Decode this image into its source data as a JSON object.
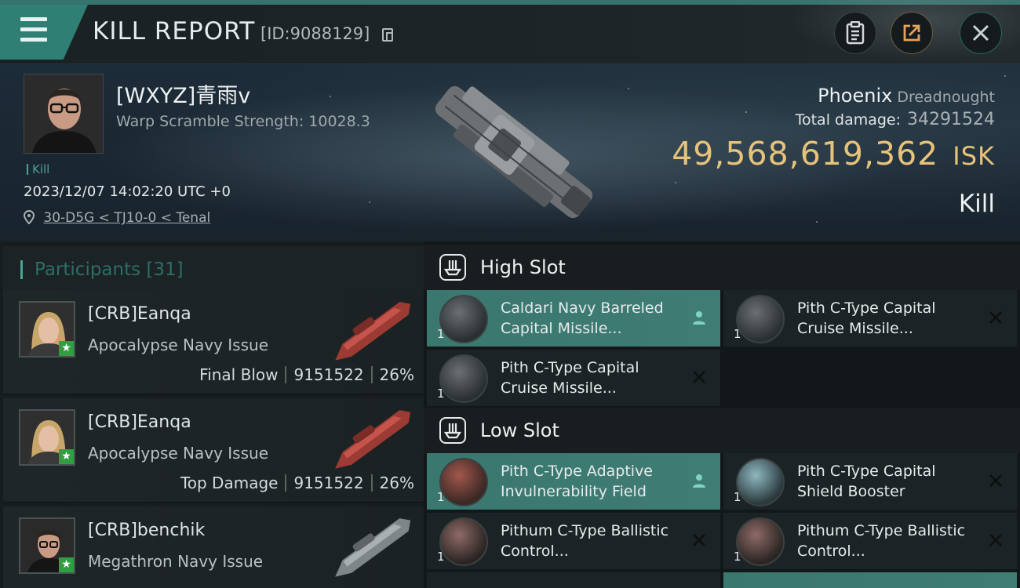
{
  "header": {
    "title": "KILL REPORT",
    "report_id": "[ID:9088129]"
  },
  "victim": {
    "name": "[WXYZ]青雨v",
    "warp_scramble": "Warp Scramble Strength: 10028.3",
    "kill_tag": "Kill",
    "time": "2023/12/07 14:02:20 UTC +0",
    "location": "30-D5G < TJ10-0 < Tenal",
    "ship_name": "Phoenix",
    "ship_class": "Dreadnought",
    "total_damage_label": "Total damage:",
    "total_damage_value": "34291524",
    "isk_value": "49,568,619,362",
    "isk_unit": "ISK",
    "result_label": "Kill"
  },
  "participants": {
    "label": "Participants",
    "count": "[31]",
    "rows": [
      {
        "name": "[CRB]Eanqa",
        "ship": "Apocalypse Navy Issue",
        "role": "Final Blow",
        "damage": "9151522",
        "percent": "26%"
      },
      {
        "name": "[CRB]Eanqa",
        "ship": "Apocalypse Navy Issue",
        "role": "Top Damage",
        "damage": "9151522",
        "percent": "26%"
      },
      {
        "name": "[CRB]benchik",
        "ship": "Megathron Navy Issue",
        "role": "",
        "damage": "",
        "percent": ""
      }
    ]
  },
  "fitting": {
    "high_slot_label": "High Slot",
    "low_slot_label": "Low Slot",
    "high": [
      {
        "name": "Caldari Navy Barreled Capital Missile...",
        "qty": "1",
        "status": "dropped"
      },
      {
        "name": "Pith C-Type Capital Cruise Missile...",
        "qty": "1",
        "status": "destroyed"
      },
      {
        "name": "Pith C-Type Capital Cruise Missile...",
        "qty": "1",
        "status": "destroyed"
      }
    ],
    "low": [
      {
        "name": "Pith C-Type Adaptive Invulnerability Field",
        "qty": "1",
        "status": "dropped"
      },
      {
        "name": "Pith C-Type Capital Shield Booster",
        "qty": "1",
        "status": "destroyed"
      },
      {
        "name": "Pithum C-Type Ballistic Control...",
        "qty": "1",
        "status": "destroyed"
      },
      {
        "name": "Pithum C-Type Ballistic Control...",
        "qty": "1",
        "status": "destroyed"
      }
    ]
  },
  "colors": {
    "accent": "#3f8f85",
    "isk": "#e6c37a",
    "active_module": "#3f7c74",
    "corp_badge": "#2ea043"
  },
  "icons": [
    "menu-icon",
    "copy-icon",
    "clipboard-icon",
    "share-icon",
    "close-icon",
    "location-pin-icon",
    "slot-icon",
    "person-icon",
    "x-icon",
    "star-icon"
  ]
}
